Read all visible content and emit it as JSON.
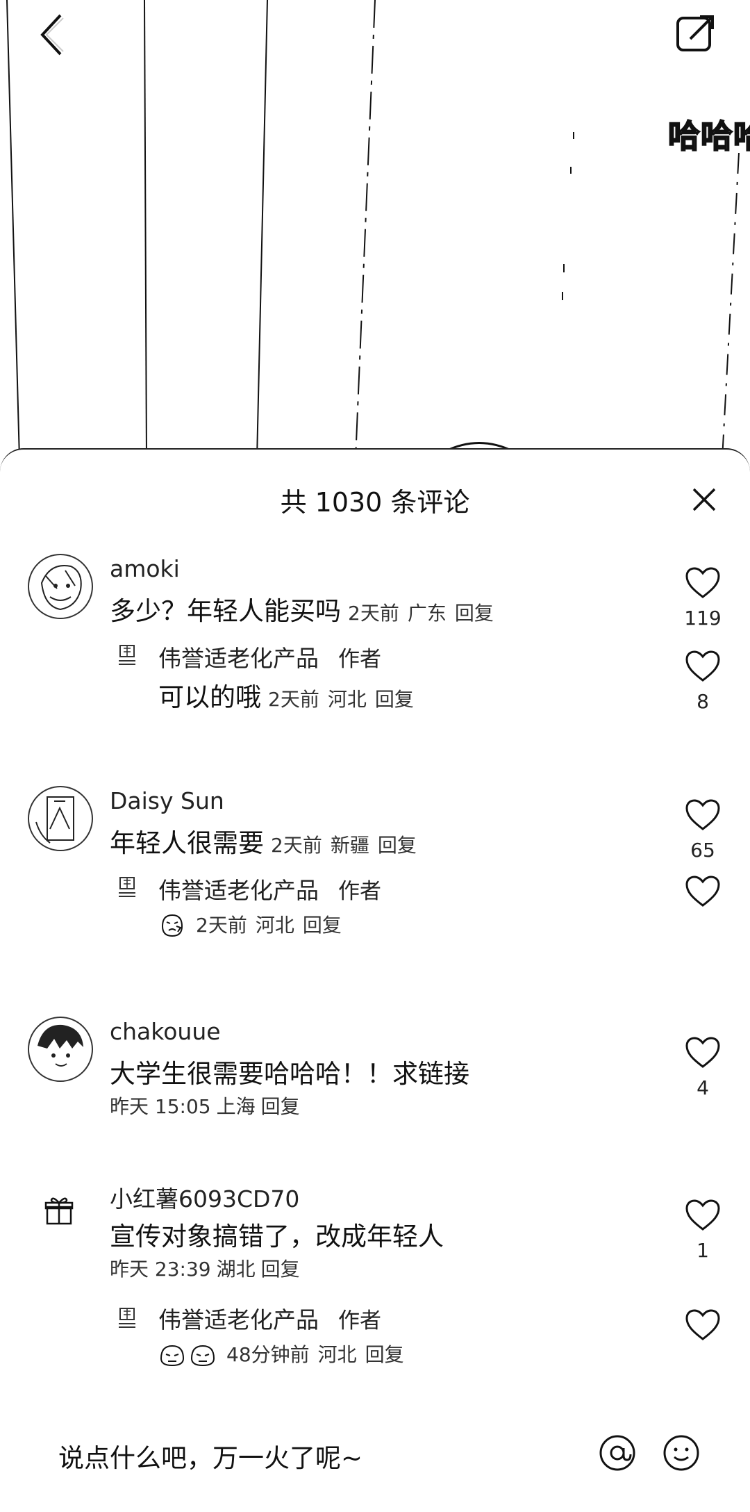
{
  "video": {
    "overlay_text": "哈哈哈"
  },
  "comments_header": {
    "title": "共 1030 条评论"
  },
  "comments": [
    {
      "username": "amoki",
      "text": "多少？年轻人能买吗",
      "time": "2天前",
      "location": "广东",
      "reply_label": "回复",
      "likes": "119",
      "reply": {
        "username": "伟誉适老化产品",
        "tag": "作者",
        "text": "可以的哦",
        "time": "2天前",
        "location": "河北",
        "reply_label": "回复",
        "likes": "8"
      }
    },
    {
      "username": "Daisy Sun",
      "text": "年轻人很需要",
      "time": "2天前",
      "location": "新疆",
      "reply_label": "回复",
      "likes": "65",
      "reply": {
        "username": "伟誉适老化产品",
        "tag": "作者",
        "text": "",
        "time": "2天前",
        "location": "河北",
        "reply_label": "回复",
        "likes": ""
      }
    },
    {
      "username": "chakouue",
      "text": "大学生很需要哈哈哈！！求链接",
      "time": "昨天 15:05",
      "location": "上海",
      "reply_label": "回复",
      "likes": "4"
    },
    {
      "username": "小红薯6093CD70",
      "text": "宣传对象搞错了，改成年轻人",
      "time": "昨天 23:39",
      "location": "湖北",
      "reply_label": "回复",
      "likes": "1",
      "reply": {
        "username": "伟誉适老化产品",
        "tag": "作者",
        "text": "",
        "time": "48分钟前",
        "location": "河北",
        "reply_label": "回复",
        "likes": ""
      }
    }
  ],
  "input": {
    "placeholder": "说点什么吧，万一火了呢~"
  },
  "icons": {
    "back": "chevron-left-icon",
    "share": "share-external-icon",
    "close": "close-icon",
    "like": "heart-outline-icon",
    "at": "at-icon",
    "emoji": "smiley-icon",
    "gift": "gift-icon"
  }
}
